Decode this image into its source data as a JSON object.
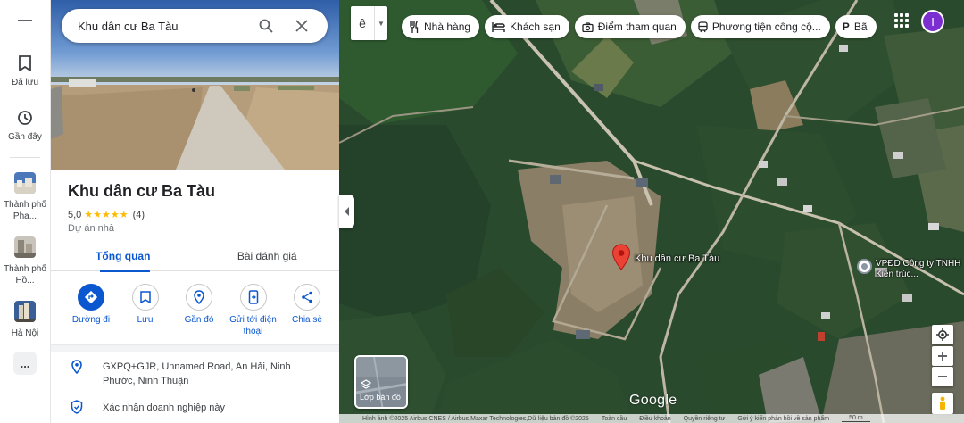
{
  "rail": {
    "saved_label": "Đã lưu",
    "recents_label": "Gần đây",
    "recent_places": [
      {
        "label": "Thành phố Pha..."
      },
      {
        "label": "Thành phố Hồ..."
      },
      {
        "label": "Hà Nội"
      }
    ],
    "more_label": "..."
  },
  "search": {
    "query": "Khu dân cư Ba Tàu"
  },
  "place": {
    "name": "Khu dân cư Ba Tàu",
    "rating": "5,0",
    "stars": "★★★★★",
    "review_count": "(4)",
    "category": "Dự án nhà",
    "address": "GXPQ+GJR, Unnamed Road, An Hải, Ninh Phước, Ninh Thuận",
    "verify": "Xác nhận doanh nghiệp này"
  },
  "tabs": [
    {
      "label": "Tổng quan",
      "active": true
    },
    {
      "label": "Bài đánh giá",
      "active": false
    }
  ],
  "actions": [
    {
      "label": "Đường đi"
    },
    {
      "label": "Lưu"
    },
    {
      "label": "Gần đó"
    },
    {
      "label": "Gửi tới điện thoại"
    },
    {
      "label": "Chia sẻ"
    }
  ],
  "map": {
    "language_value": "ê",
    "chips": [
      {
        "label": "Nhà hàng",
        "icon": "restaurant-icon"
      },
      {
        "label": "Khách sạn",
        "icon": "hotel-icon"
      },
      {
        "label": "Điểm tham quan",
        "icon": "camera-icon"
      },
      {
        "label": "Phương tiện công cộ...",
        "icon": "transit-icon"
      },
      {
        "label": "Bã",
        "icon": "parking-icon"
      }
    ],
    "account_initial": "I",
    "pin_label": "Khu dân cư Ba Tàu",
    "poi_label": "VPĐD Công ty TNHH Kiến trúc...",
    "layers_label": "Lớp bản đồ",
    "logo": "Google",
    "footer": {
      "imagery": "Hình ảnh ©2025 Airbus,CNES / Airbus,Maxar Technologies,Dữ liệu bản đồ ©2025",
      "security": "Toàn cầu",
      "terms": "Điều khoản",
      "privacy": "Quyền riêng tư",
      "feedback": "Gửi ý kiến phản hồi về sản phẩm",
      "scale": "50 m"
    }
  },
  "colors": {
    "accent": "#0b57d0",
    "star": "#fbbc04",
    "pin": "#ea4335",
    "avatar": "#7b2fd0"
  }
}
